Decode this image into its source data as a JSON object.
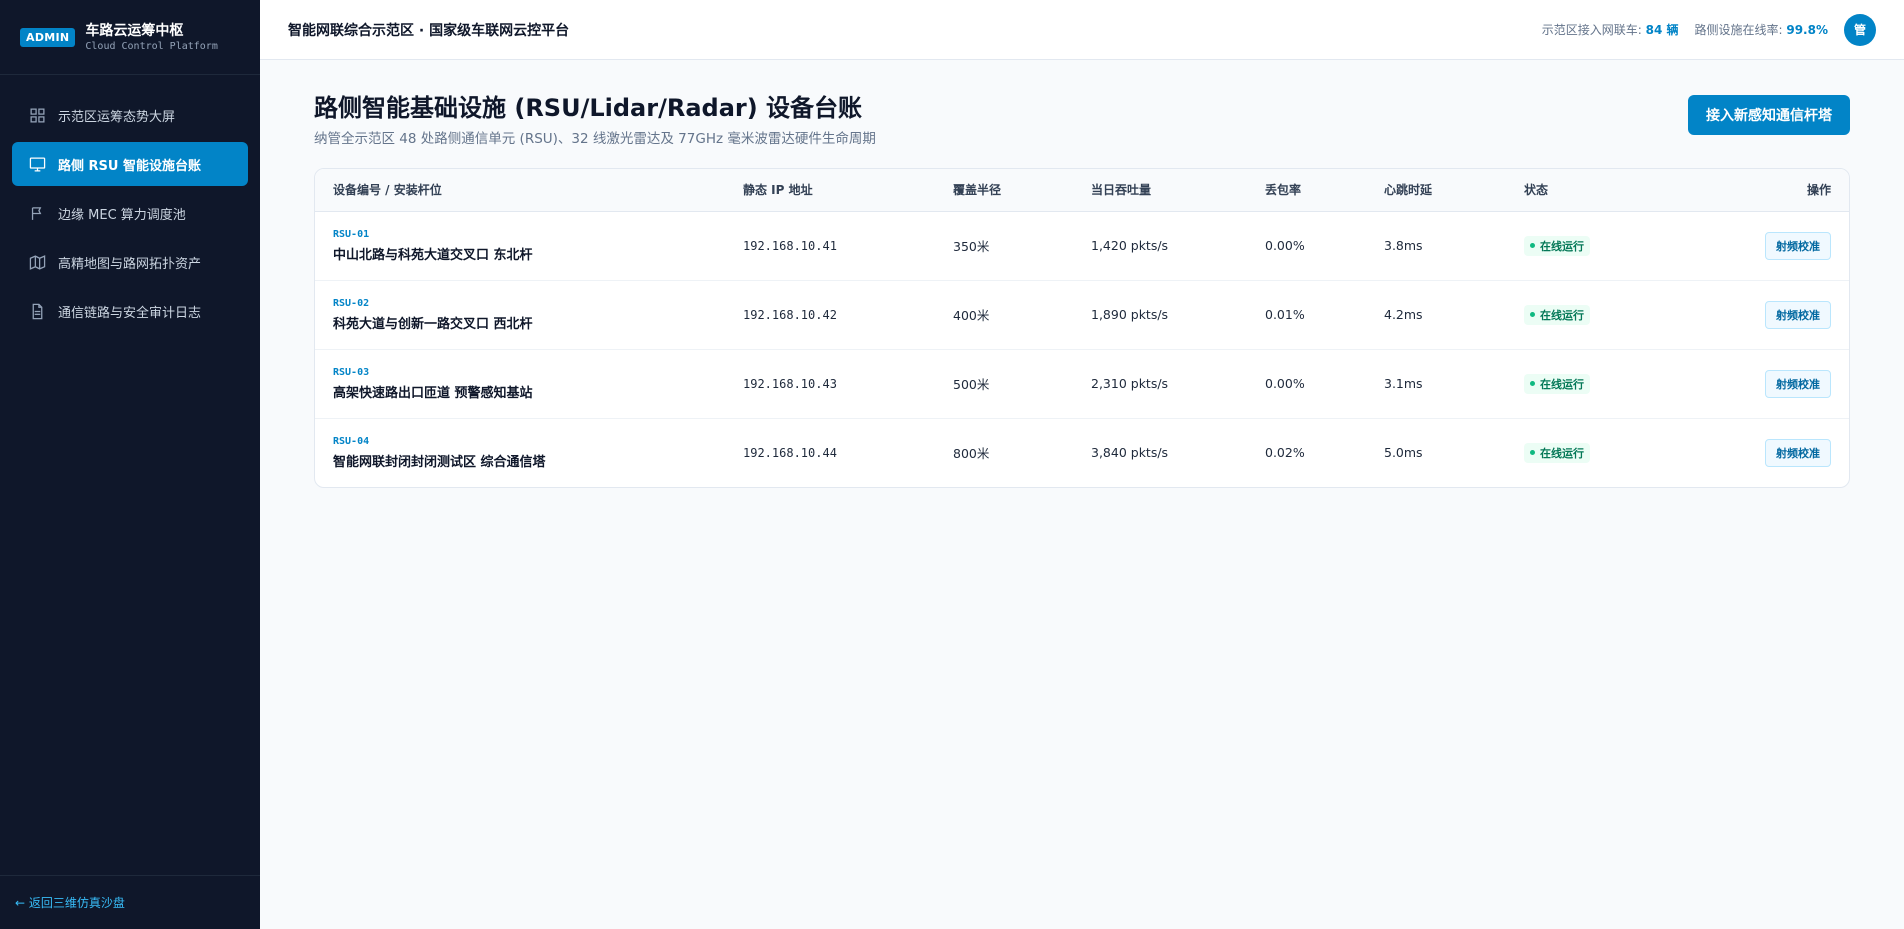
{
  "brand": {
    "badge": "ADMIN",
    "title": "车路云运筹中枢",
    "subtitle": "Cloud Control Platform"
  },
  "sidebar": {
    "items": [
      {
        "label": "示范区运筹态势大屏",
        "icon": "grid-icon",
        "active": false
      },
      {
        "label": "路侧 RSU 智能设施台账",
        "icon": "monitor-icon",
        "active": true
      },
      {
        "label": "边缘 MEC 算力调度池",
        "icon": "flag-icon",
        "active": false
      },
      {
        "label": "高精地图与路网拓扑资产",
        "icon": "map-icon",
        "active": false
      },
      {
        "label": "通信链路与安全审计日志",
        "icon": "document-icon",
        "active": false
      }
    ],
    "footer_link": "← 返回三维仿真沙盘"
  },
  "header": {
    "title": "智能网联综合示范区 · 国家级车联网云控平台",
    "stat1_label": "示范区接入网联车:",
    "stat1_value": "84 辆",
    "stat2_label": "路侧设施在线率:",
    "stat2_value": "99.8%",
    "avatar": "管"
  },
  "page": {
    "title": "路侧智能基础设施 (RSU/Lidar/Radar) 设备台账",
    "subtitle": "纳管全示范区 48 处路侧通信单元 (RSU)、32 线激光雷达及 77GHz 毫米波雷达硬件生命周期",
    "primary_button": "接入新感知通信杆塔"
  },
  "table": {
    "columns": [
      "设备编号 / 安装杆位",
      "静态 IP 地址",
      "覆盖半径",
      "当日吞吐量",
      "丢包率",
      "心跳时延",
      "状态",
      "操作"
    ],
    "rows": [
      {
        "id": "RSU-01",
        "name": "中山北路与科苑大道交叉口 东北杆",
        "ip": "192.168.10.41",
        "radius": "350米",
        "throughput": "1,420 pkts/s",
        "loss": "0.00%",
        "latency": "3.8ms",
        "status": "在线运行",
        "action": "射频校准"
      },
      {
        "id": "RSU-02",
        "name": "科苑大道与创新一路交叉口 西北杆",
        "ip": "192.168.10.42",
        "radius": "400米",
        "throughput": "1,890 pkts/s",
        "loss": "0.01%",
        "latency": "4.2ms",
        "status": "在线运行",
        "action": "射频校准"
      },
      {
        "id": "RSU-03",
        "name": "高架快速路出口匝道 预警感知基站",
        "ip": "192.168.10.43",
        "radius": "500米",
        "throughput": "2,310 pkts/s",
        "loss": "0.00%",
        "latency": "3.1ms",
        "status": "在线运行",
        "action": "射频校准"
      },
      {
        "id": "RSU-04",
        "name": "智能网联封闭封闭测试区 综合通信塔",
        "ip": "192.168.10.44",
        "radius": "800米",
        "throughput": "3,840 pkts/s",
        "loss": "0.02%",
        "latency": "5.0ms",
        "status": "在线运行",
        "action": "射频校准"
      }
    ]
  },
  "colors": {
    "accent": "#0284c7",
    "sidebar_bg": "#0f172a",
    "status_green": "#047857"
  }
}
